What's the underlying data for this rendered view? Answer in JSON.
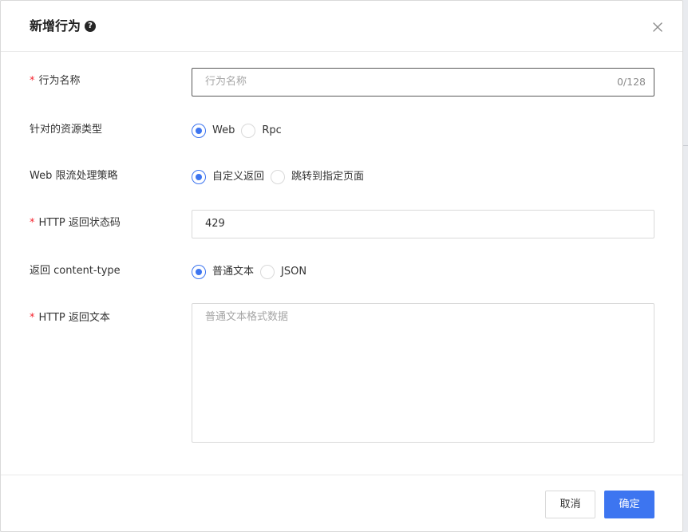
{
  "modal": {
    "title": "新增行为",
    "help_icon_glyph": "?",
    "icons": {
      "help": "question-circle-icon",
      "close": "close-icon"
    }
  },
  "form": {
    "action_name": {
      "required_mark": "*",
      "label": "行为名称",
      "placeholder": "行为名称",
      "counter": "0/128"
    },
    "resource_type": {
      "label": "针对的资源类型",
      "options": [
        {
          "label": "Web",
          "checked": true
        },
        {
          "label": "Rpc",
          "checked": false
        }
      ]
    },
    "web_strategy": {
      "label": "Web 限流处理策略",
      "options": [
        {
          "label": "自定义返回",
          "checked": true
        },
        {
          "label": "跳转到指定页面",
          "checked": false
        }
      ]
    },
    "http_status": {
      "required_mark": "*",
      "label": "HTTP 返回状态码",
      "value": "429"
    },
    "content_type": {
      "label": "返回 content-type",
      "options": [
        {
          "label": "普通文本",
          "checked": true
        },
        {
          "label": "JSON",
          "checked": false
        }
      ]
    },
    "http_body": {
      "required_mark": "*",
      "label": "HTTP 返回文本",
      "placeholder": "普通文本格式数据"
    }
  },
  "footer": {
    "cancel_label": "取消",
    "ok_label": "确定"
  },
  "colors": {
    "primary": "#3d75f0",
    "required": "#f5222d",
    "border": "#d9d9d9"
  }
}
